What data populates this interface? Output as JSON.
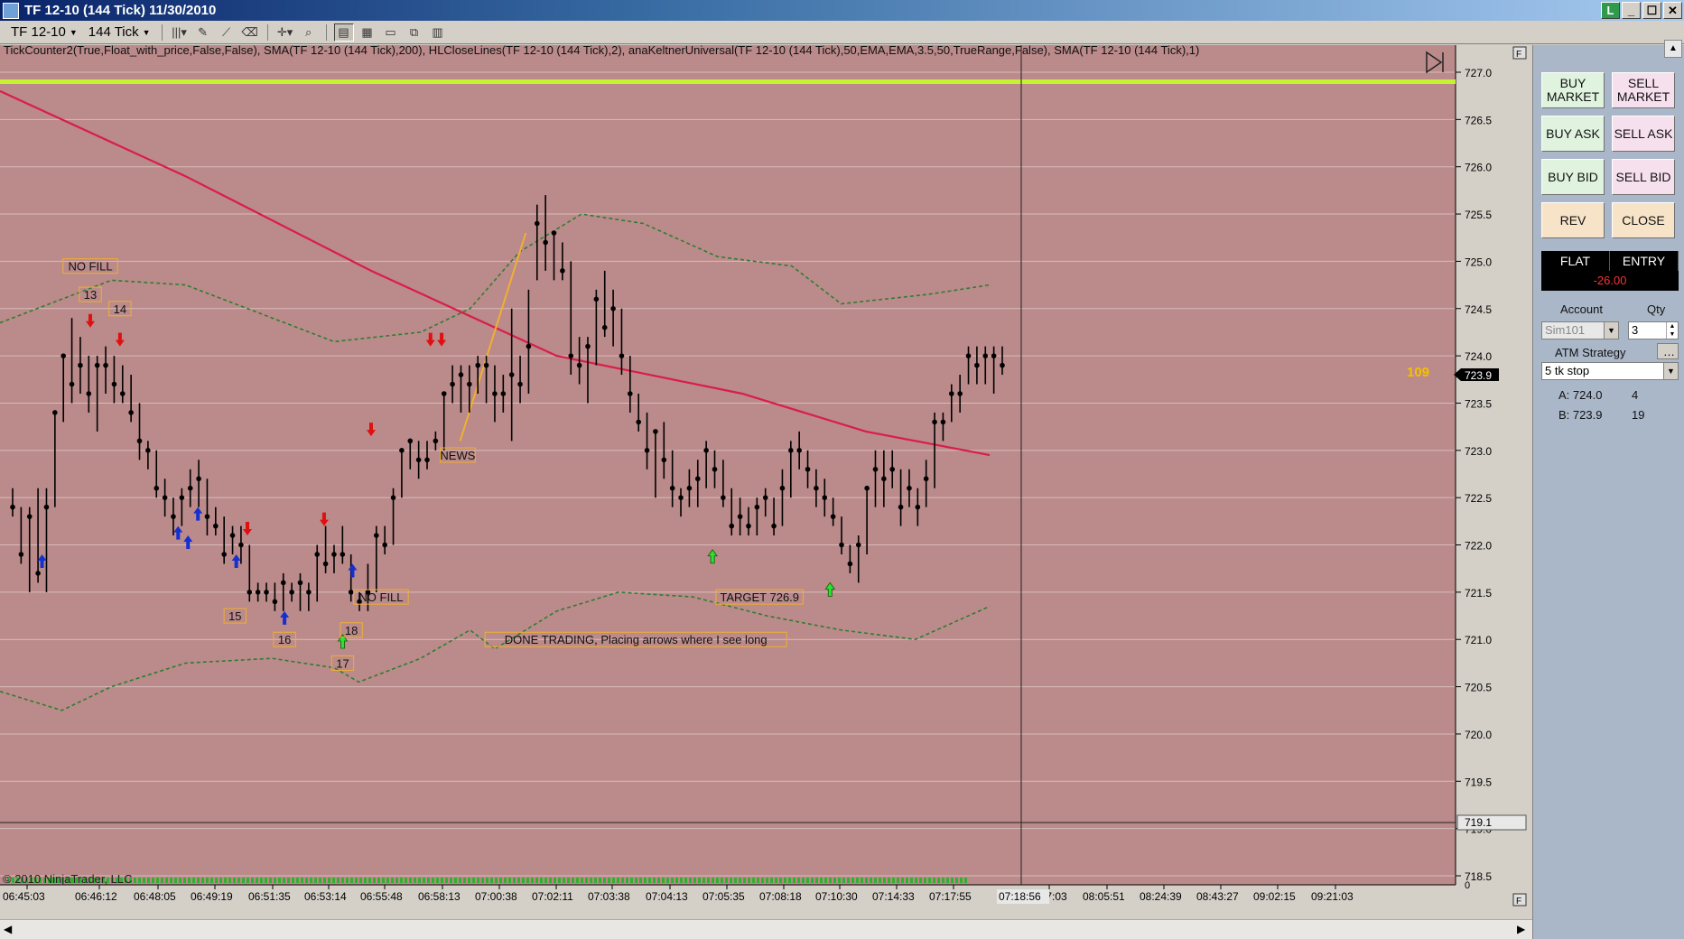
{
  "window": {
    "title": "TF 12-10 (144 Tick)  11/30/2010",
    "buttons": [
      "L",
      "_",
      "☐",
      "✕"
    ]
  },
  "toolbar": {
    "instrument": "TF 12-10",
    "interval": "144 Tick"
  },
  "indicators_label": "TickCounter2(True,Float_with_price,False,False),  SMA(TF  12-10  (144  Tick),200),  HLCloseLines(TF  12-10  (144  Tick),2),  anaKeltnerUniversal(TF  12-10  (144  Tick),50,EMA,EMA,3.5,50,TrueRange,False),  SMA(TF  12-10  (144  Tick),1)",
  "copyright": "© 2010 NinjaTrader, LLC",
  "tick_counter": "109",
  "last_price": "723.9",
  "crosshair_price": "719.1",
  "crosshair_time": "07:18:56",
  "chart_data": {
    "type": "candlestick",
    "ylim": [
      718.5,
      727.0
    ],
    "y_ticks": [
      "727.0",
      "726.5",
      "726.0",
      "725.5",
      "725.0",
      "724.5",
      "724.0",
      "723.5",
      "723.0",
      "722.5",
      "722.0",
      "721.5",
      "721.0",
      "720.5",
      "720.0",
      "719.5",
      "719.0",
      "718.5"
    ],
    "x_ticks": [
      "06:45:03",
      "06:46:12",
      "06:48:05",
      "06:49:19",
      "06:51:35",
      "06:53:14",
      "06:55:48",
      "06:58:13",
      "07:00:38",
      "07:02:11",
      "07:03:38",
      "07:04:13",
      "07:05:35",
      "07:08:18",
      "07:10:30",
      "07:14:33",
      "07:17:55",
      "07:47:03",
      "08:05:51",
      "08:24:39",
      "08:43:27",
      "09:02:15",
      "09:21:03"
    ],
    "close_level": 726.9,
    "volume_baseline_label": "0",
    "bars": [
      [
        722.6,
        722.4,
        722.6,
        722.3
      ],
      [
        722.3,
        721.9,
        722.4,
        721.8
      ],
      [
        721.8,
        722.3,
        722.4,
        721.5
      ],
      [
        722.3,
        721.7,
        722.6,
        721.6
      ],
      [
        721.7,
        722.4,
        722.6,
        721.5
      ],
      [
        722.4,
        723.4,
        723.4,
        722.4
      ],
      [
        723.4,
        724.0,
        724.0,
        723.3
      ],
      [
        724.0,
        723.7,
        724.4,
        723.5
      ],
      [
        723.7,
        723.9,
        724.2,
        723.6
      ],
      [
        723.9,
        723.6,
        724.0,
        723.4
      ],
      [
        723.6,
        723.9,
        724.0,
        723.2
      ],
      [
        723.9,
        723.9,
        724.1,
        723.6
      ],
      [
        723.9,
        723.7,
        724.0,
        723.5
      ],
      [
        723.7,
        723.6,
        723.9,
        723.5
      ],
      [
        723.6,
        723.4,
        723.8,
        723.3
      ],
      [
        723.4,
        723.1,
        723.5,
        722.9
      ],
      [
        723.1,
        723.0,
        723.1,
        722.8
      ],
      [
        723.0,
        722.6,
        723.0,
        722.5
      ],
      [
        722.6,
        722.5,
        722.7,
        722.3
      ],
      [
        722.5,
        722.3,
        722.5,
        722.1
      ],
      [
        722.3,
        722.5,
        722.6,
        722.2
      ],
      [
        722.5,
        722.6,
        722.8,
        722.4
      ],
      [
        722.6,
        722.7,
        722.9,
        722.4
      ],
      [
        722.7,
        722.3,
        722.7,
        722.1
      ],
      [
        722.3,
        722.2,
        722.4,
        722.1
      ],
      [
        722.2,
        721.9,
        722.3,
        721.8
      ],
      [
        721.9,
        722.1,
        722.2,
        721.9
      ],
      [
        722.1,
        722.0,
        722.2,
        721.8
      ],
      [
        722.0,
        721.5,
        722.0,
        721.4
      ],
      [
        721.5,
        721.5,
        721.6,
        721.4
      ],
      [
        721.5,
        721.5,
        721.6,
        721.4
      ],
      [
        721.5,
        721.4,
        721.6,
        721.3
      ],
      [
        721.4,
        721.6,
        721.7,
        721.3
      ],
      [
        721.6,
        721.5,
        721.6,
        721.4
      ],
      [
        721.5,
        721.6,
        721.7,
        721.3
      ],
      [
        721.6,
        721.5,
        721.6,
        721.3
      ],
      [
        721.5,
        721.9,
        722.0,
        721.4
      ],
      [
        721.9,
        721.8,
        722.2,
        721.7
      ],
      [
        721.8,
        721.9,
        722.0,
        721.7
      ],
      [
        721.9,
        721.9,
        722.2,
        721.8
      ],
      [
        721.9,
        721.5,
        721.9,
        721.4
      ],
      [
        721.5,
        721.4,
        721.5,
        721.3
      ],
      [
        721.4,
        721.5,
        721.8,
        721.3
      ],
      [
        721.5,
        722.1,
        722.2,
        721.5
      ],
      [
        722.1,
        722.0,
        722.2,
        721.9
      ],
      [
        722.0,
        722.5,
        722.6,
        722.0
      ],
      [
        722.5,
        723.0,
        723.0,
        722.5
      ],
      [
        723.0,
        723.1,
        723.1,
        722.8
      ],
      [
        723.1,
        722.9,
        723.1,
        722.7
      ],
      [
        722.9,
        722.9,
        723.1,
        722.8
      ],
      [
        722.9,
        723.1,
        723.2,
        723.0
      ],
      [
        723.1,
        723.6,
        723.6,
        723.0
      ],
      [
        723.6,
        723.7,
        723.9,
        723.5
      ],
      [
        723.7,
        723.8,
        723.9,
        723.4
      ],
      [
        723.8,
        723.7,
        723.9,
        723.4
      ],
      [
        723.7,
        723.9,
        724.0,
        723.6
      ],
      [
        723.9,
        723.9,
        724.0,
        723.5
      ],
      [
        723.9,
        723.6,
        723.9,
        723.3
      ],
      [
        723.6,
        723.6,
        723.8,
        723.4
      ],
      [
        723.6,
        723.8,
        724.5,
        723.1
      ],
      [
        723.8,
        723.7,
        724.0,
        723.5
      ],
      [
        723.7,
        724.1,
        724.7,
        723.6
      ],
      [
        724.1,
        725.4,
        725.6,
        724.8
      ],
      [
        725.4,
        725.2,
        725.7,
        724.9
      ],
      [
        725.2,
        725.3,
        725.3,
        724.8
      ],
      [
        725.3,
        724.9,
        725.2,
        724.8
      ],
      [
        724.9,
        724.0,
        725.0,
        723.8
      ],
      [
        724.0,
        723.9,
        724.2,
        723.7
      ],
      [
        723.9,
        724.1,
        724.2,
        723.5
      ],
      [
        724.1,
        724.6,
        724.7,
        723.9
      ],
      [
        724.6,
        724.3,
        724.9,
        724.2
      ],
      [
        724.3,
        724.5,
        724.7,
        724.1
      ],
      [
        724.5,
        724.0,
        724.5,
        723.8
      ],
      [
        724.0,
        723.6,
        724.0,
        723.4
      ],
      [
        723.6,
        723.3,
        723.6,
        723.2
      ],
      [
        723.3,
        723.0,
        723.4,
        722.8
      ],
      [
        723.0,
        723.2,
        723.2,
        722.5
      ],
      [
        723.2,
        722.9,
        723.3,
        722.7
      ],
      [
        722.9,
        722.6,
        723.0,
        722.4
      ],
      [
        722.6,
        722.5,
        722.6,
        722.3
      ],
      [
        722.5,
        722.6,
        722.8,
        722.4
      ],
      [
        722.6,
        722.7,
        722.9,
        722.4
      ],
      [
        722.7,
        723.0,
        723.1,
        722.6
      ],
      [
        723.0,
        722.8,
        723.0,
        722.6
      ],
      [
        722.8,
        722.5,
        722.9,
        722.4
      ],
      [
        722.5,
        722.2,
        722.6,
        722.1
      ],
      [
        722.2,
        722.3,
        722.5,
        722.1
      ],
      [
        722.3,
        722.2,
        722.4,
        722.1
      ],
      [
        722.2,
        722.4,
        722.5,
        722.1
      ],
      [
        722.4,
        722.5,
        722.6,
        722.3
      ],
      [
        722.5,
        722.2,
        722.5,
        722.1
      ],
      [
        722.2,
        722.6,
        722.8,
        722.2
      ],
      [
        722.6,
        723.0,
        723.1,
        722.5
      ],
      [
        723.0,
        723.0,
        723.2,
        722.8
      ],
      [
        723.0,
        722.8,
        723.0,
        722.6
      ],
      [
        722.8,
        722.6,
        722.8,
        722.4
      ],
      [
        722.6,
        722.5,
        722.7,
        722.3
      ],
      [
        722.5,
        722.3,
        722.5,
        722.2
      ],
      [
        722.3,
        722.0,
        722.3,
        721.9
      ],
      [
        722.0,
        721.8,
        722.0,
        721.7
      ],
      [
        721.8,
        722.0,
        722.1,
        721.6
      ],
      [
        722.0,
        722.6,
        722.6,
        721.9
      ],
      [
        722.6,
        722.8,
        723.0,
        722.4
      ],
      [
        722.8,
        722.7,
        723.0,
        722.4
      ],
      [
        722.7,
        722.8,
        723.0,
        722.6
      ],
      [
        722.8,
        722.4,
        722.8,
        722.2
      ],
      [
        722.4,
        722.6,
        722.8,
        722.4
      ],
      [
        722.6,
        722.4,
        722.6,
        722.2
      ],
      [
        722.4,
        722.7,
        722.9,
        722.4
      ],
      [
        722.7,
        723.3,
        723.4,
        722.6
      ],
      [
        723.3,
        723.3,
        723.4,
        723.1
      ],
      [
        723.3,
        723.6,
        723.7,
        723.3
      ],
      [
        723.6,
        723.6,
        723.8,
        723.4
      ],
      [
        723.6,
        724.0,
        724.1,
        723.7
      ],
      [
        724.0,
        723.9,
        724.1,
        723.7
      ],
      [
        723.9,
        724.0,
        724.1,
        723.7
      ],
      [
        724.0,
        724.0,
        724.1,
        723.6
      ],
      [
        724.0,
        723.9,
        724.1,
        723.8
      ]
    ],
    "sma200": [
      [
        0,
        726.8
      ],
      [
        0.15,
        725.9
      ],
      [
        0.3,
        724.9
      ],
      [
        0.45,
        724.0
      ],
      [
        0.6,
        723.6
      ],
      [
        0.7,
        723.2
      ],
      [
        0.8,
        722.95
      ]
    ],
    "keltner_upper": [
      [
        0,
        724.35
      ],
      [
        0.05,
        724.6
      ],
      [
        0.09,
        724.8
      ],
      [
        0.15,
        724.75
      ],
      [
        0.22,
        724.4
      ],
      [
        0.27,
        724.15
      ],
      [
        0.34,
        724.25
      ],
      [
        0.38,
        724.5
      ],
      [
        0.42,
        725.1
      ],
      [
        0.47,
        725.5
      ],
      [
        0.52,
        725.4
      ],
      [
        0.58,
        725.05
      ],
      [
        0.64,
        724.95
      ],
      [
        0.68,
        724.55
      ],
      [
        0.75,
        724.65
      ],
      [
        0.8,
        724.75
      ]
    ],
    "keltner_lower": [
      [
        0,
        720.45
      ],
      [
        0.05,
        720.25
      ],
      [
        0.09,
        720.5
      ],
      [
        0.15,
        720.75
      ],
      [
        0.22,
        720.8
      ],
      [
        0.27,
        720.7
      ],
      [
        0.29,
        720.55
      ],
      [
        0.34,
        720.8
      ],
      [
        0.38,
        721.1
      ],
      [
        0.4,
        720.9
      ],
      [
        0.45,
        721.3
      ],
      [
        0.5,
        721.5
      ],
      [
        0.56,
        721.45
      ],
      [
        0.62,
        721.25
      ],
      [
        0.68,
        721.1
      ],
      [
        0.74,
        721.0
      ],
      [
        0.8,
        721.35
      ]
    ],
    "news_line": [
      [
        0.372,
        723.1
      ],
      [
        0.425,
        725.3
      ]
    ],
    "annotations": [
      {
        "text": "NO FILL",
        "x": 0.073,
        "y": 724.95
      },
      {
        "text": "13",
        "x": 0.073,
        "y": 724.65
      },
      {
        "text": "14",
        "x": 0.097,
        "y": 724.5
      },
      {
        "text": "NEWS",
        "x": 0.37,
        "y": 722.95
      },
      {
        "text": "NO FILL",
        "x": 0.308,
        "y": 721.45
      },
      {
        "text": "15",
        "x": 0.19,
        "y": 721.25
      },
      {
        "text": "16",
        "x": 0.23,
        "y": 721.0
      },
      {
        "text": "18",
        "x": 0.284,
        "y": 721.1
      },
      {
        "text": "17",
        "x": 0.277,
        "y": 720.75
      },
      {
        "text": "TARGET 726.9",
        "x": 0.614,
        "y": 721.45
      },
      {
        "text": "DONE TRADING, Placing arrows where I see long",
        "x": 0.514,
        "y": 721.0
      }
    ],
    "down_arrows": [
      [
        0.073,
        724.3
      ],
      [
        0.097,
        724.1
      ],
      [
        0.2,
        722.1
      ],
      [
        0.262,
        722.2
      ],
      [
        0.3,
        723.15
      ],
      [
        0.348,
        724.1
      ],
      [
        0.357,
        724.1
      ]
    ],
    "up_arrows_blue": [
      [
        0.034,
        721.9
      ],
      [
        0.144,
        722.2
      ],
      [
        0.152,
        722.1
      ],
      [
        0.16,
        722.4
      ],
      [
        0.191,
        721.9
      ],
      [
        0.23,
        721.3
      ],
      [
        0.285,
        721.8
      ]
    ],
    "up_arrows_green": [
      [
        0.277,
        721.05
      ],
      [
        0.576,
        721.95
      ],
      [
        0.671,
        721.6
      ]
    ]
  },
  "panel": {
    "buy_market": "BUY MARKET",
    "sell_market": "SELL MARKET",
    "buy_ask": "BUY ASK",
    "sell_ask": "SELL ASK",
    "buy_bid": "BUY BID",
    "sell_bid": "SELL BID",
    "rev": "REV",
    "close": "CLOSE",
    "flat": "FLAT",
    "entry": "ENTRY",
    "pnl": "-26.00",
    "account_label": "Account",
    "qty_label": "Qty",
    "account": "Sim101",
    "qty": "3",
    "atm_label": "ATM Strategy",
    "atm_value": "5 tk stop",
    "ask": "A: 724.0",
    "ask_size": "4",
    "bid": "B: 723.9",
    "bid_size": "19"
  },
  "colors": {
    "chart_bg": "#bb8a8a",
    "sma200": "#d81e4a",
    "keltner": "#2e7d32",
    "close_line": "#c6f232",
    "annotation": "#f0b030",
    "tick_counter": "#f5c000"
  }
}
